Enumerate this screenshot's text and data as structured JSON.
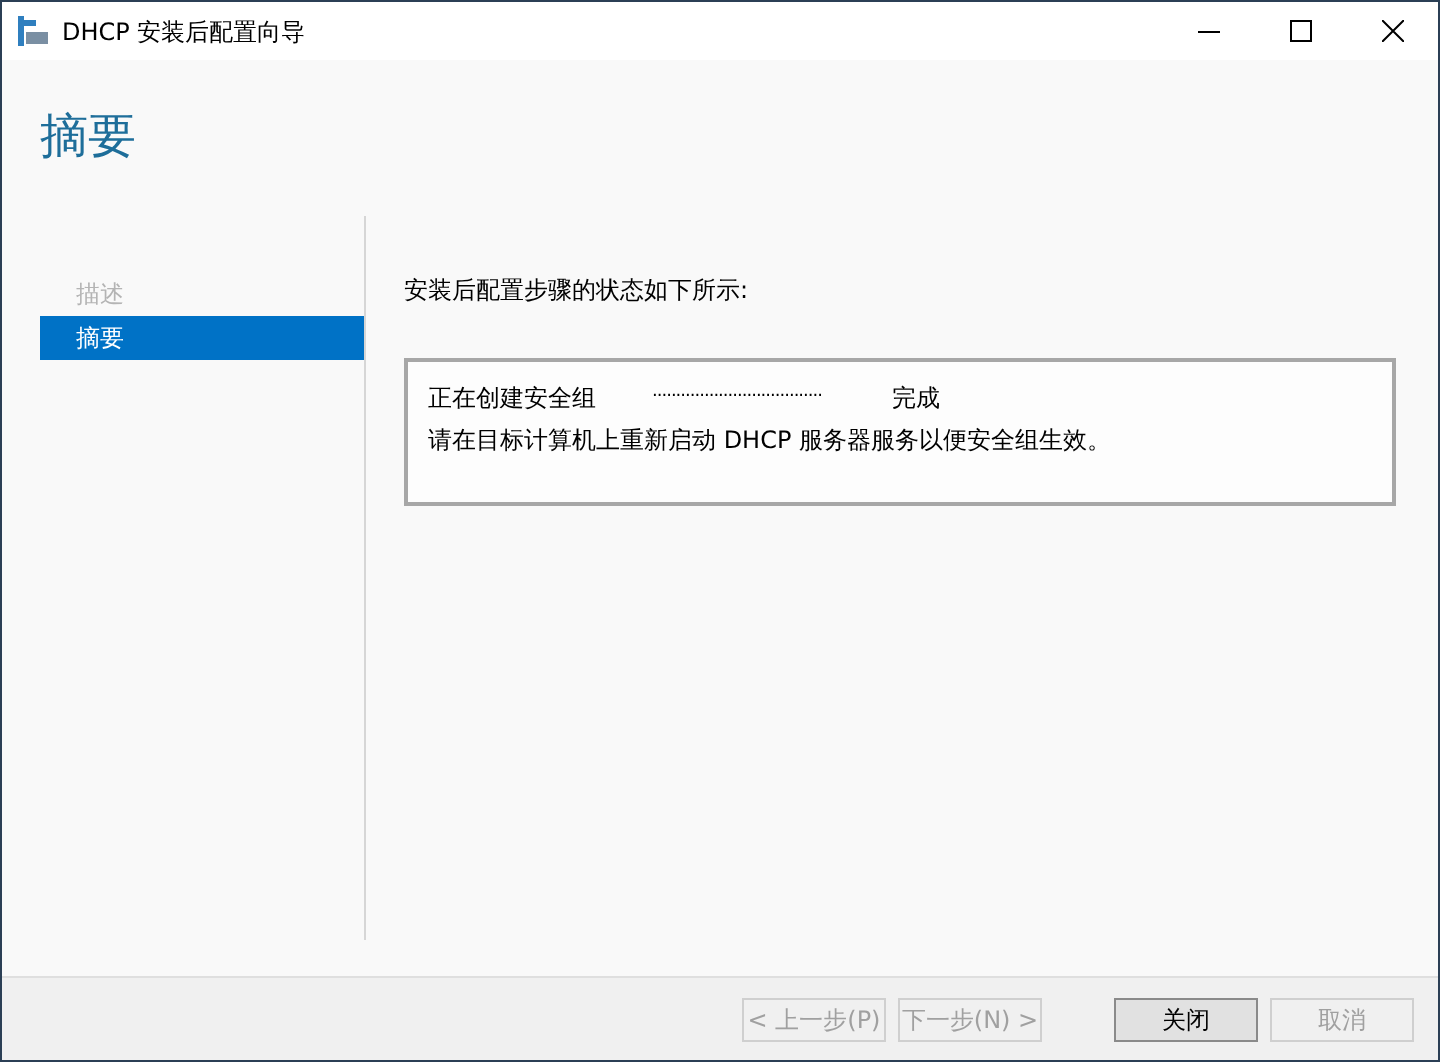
{
  "window": {
    "title": "DHCP 安装后配置向导"
  },
  "heading": "摘要",
  "nav": [
    {
      "label": "描述",
      "selected": false,
      "disabled": true
    },
    {
      "label": "摘要",
      "selected": true,
      "disabled": false
    }
  ],
  "intro": "安装后配置步骤的状态如下所示:",
  "steps": [
    {
      "name": "正在创建安全组",
      "leader": "....................................",
      "result": "完成"
    }
  ],
  "message": "请在目标计算机上重新启动 DHCP 服务器服务以便安全组生效。",
  "buttons": [
    {
      "label": "< 上一步(P)",
      "disabled": true,
      "default": false
    },
    {
      "label": "下一步(N) >",
      "disabled": true,
      "default": false
    },
    {
      "label": "关闭",
      "disabled": false,
      "default": true
    },
    {
      "label": "取消",
      "disabled": true,
      "default": false
    }
  ]
}
